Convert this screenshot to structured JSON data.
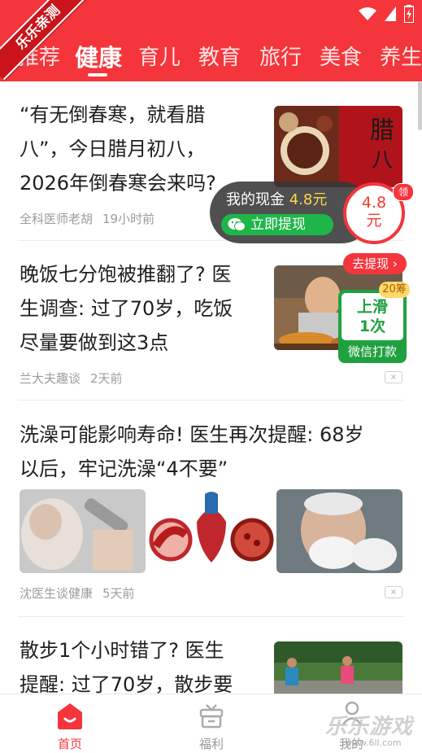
{
  "status_bar": {
    "icons": [
      "wifi-icon",
      "signal-icon",
      "battery-icon"
    ]
  },
  "watermark_ribbon": "乐乐亲测",
  "tabs": [
    {
      "label": "推荐"
    },
    {
      "label": "健康",
      "active": true
    },
    {
      "label": "育儿"
    },
    {
      "label": "教育"
    },
    {
      "label": "旅行"
    },
    {
      "label": "美食"
    },
    {
      "label": "养生"
    }
  ],
  "articles": [
    {
      "title_lines": [
        "“有无倒春寒，就看腊",
        "八”，今日腊月初八，",
        "2026年倒春寒会来吗?"
      ],
      "source": "全科医师老胡",
      "time": "19小时前"
    },
    {
      "title_lines": [
        "晚饭七分饱被推翻了? 医",
        "生调查: 过了70岁，吃饭",
        "尽量要做到这3点"
      ],
      "source": "兰大夫趣谈",
      "time": "2天前"
    },
    {
      "title_lines": [
        "洗澡可能影响寿命! 医生再次提醒: 68岁",
        "以后，牢记洗澡“4不要”"
      ],
      "source": "沈医生谈健康",
      "time": "5天前"
    },
    {
      "title_lines": [
        "散步1个小时错了? 医生",
        "提醒: 过了70岁，散步要"
      ]
    }
  ],
  "cash_popup": {
    "label": "我的现金",
    "amount": "4.8元",
    "withdraw_button": "立即提现",
    "coin_value": "4.8",
    "coin_unit": "元",
    "coin_badge": "领"
  },
  "task_widget": {
    "go_button": "去提现",
    "badge": "20筹",
    "line1": "上滑",
    "line2": "1次",
    "footer": "微信打款"
  },
  "close_mark": "×",
  "bottom_nav": [
    {
      "label": "首页",
      "active": true
    },
    {
      "label": "福利"
    },
    {
      "label": "我的"
    }
  ],
  "site_watermark": {
    "text": "乐乐游戏",
    "sub": "www.6ll.com"
  },
  "colors": {
    "brand_red": "#f5353c",
    "wechat_green": "#1fb649",
    "amount_yellow": "#ffd54a"
  }
}
